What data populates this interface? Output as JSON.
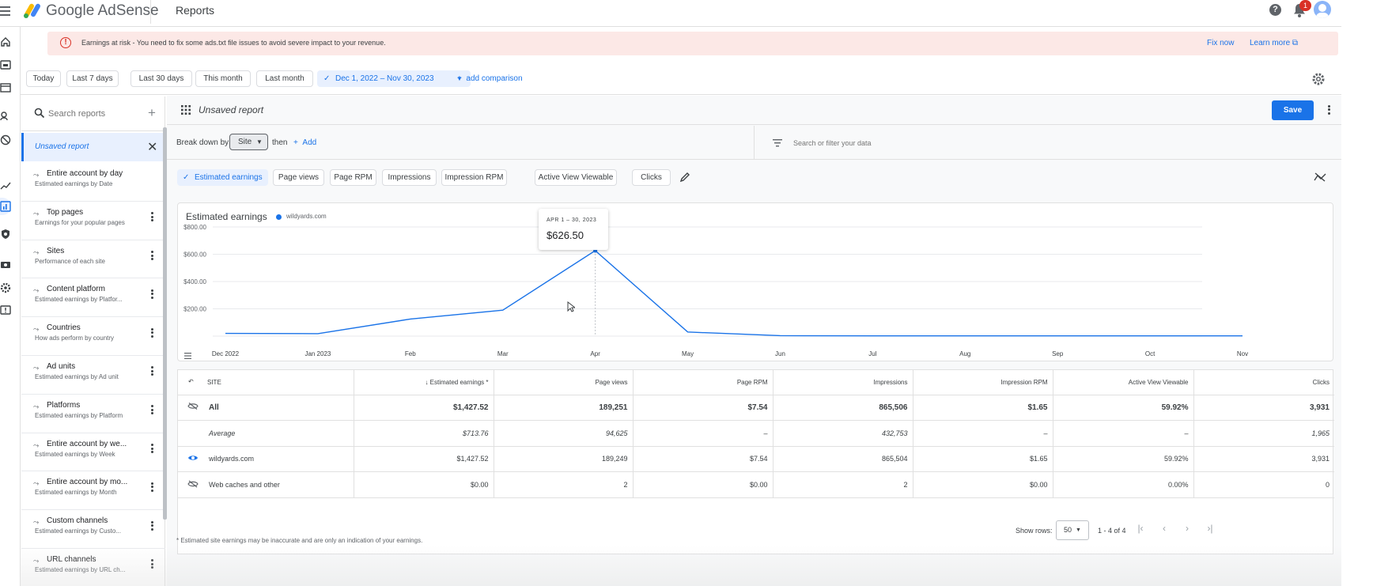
{
  "app": {
    "brand": "Google AdSense",
    "page_title": "Reports",
    "notification_count": "1",
    "help_glyph": "?"
  },
  "alert": {
    "text": "Earnings at risk - You need to fix some ads.txt file issues to avoid severe impact to your revenue.",
    "fix_label": "Fix now",
    "learn_label": "Learn more",
    "color": "#fce8e6"
  },
  "date_range": {
    "presets": [
      "Today",
      "Last 7 days",
      "Last 30 days",
      "This month",
      "Last month"
    ],
    "selected": "Dec 1, 2022 – Nov 30, 2023",
    "add_comparison": "add comparison"
  },
  "sidebar": {
    "search_placeholder": "Search reports",
    "unsaved_label": "Unsaved report",
    "reports": [
      {
        "title": "Entire account by day",
        "subtitle": "Estimated earnings by Date",
        "has_menu": false
      },
      {
        "title": "Top pages",
        "subtitle": "Earnings for your popular pages",
        "has_menu": true
      },
      {
        "title": "Sites",
        "subtitle": "Performance of each site",
        "has_menu": true
      },
      {
        "title": "Content platform",
        "subtitle": "Estimated earnings by Platfor...",
        "has_menu": true
      },
      {
        "title": "Countries",
        "subtitle": "How ads perform by country",
        "has_menu": true
      },
      {
        "title": "Ad units",
        "subtitle": "Estimated earnings by Ad unit",
        "has_menu": true
      },
      {
        "title": "Platforms",
        "subtitle": "Estimated earnings by Platform",
        "has_menu": true
      },
      {
        "title": "Entire account by we...",
        "subtitle": "Estimated earnings by Week",
        "has_menu": true
      },
      {
        "title": "Entire account by mo...",
        "subtitle": "Estimated earnings by Month",
        "has_menu": true
      },
      {
        "title": "Custom channels",
        "subtitle": "Estimated earnings by Custo...",
        "has_menu": true
      },
      {
        "title": "URL channels",
        "subtitle": "Estimated earnings by URL ch...",
        "has_menu": true
      }
    ]
  },
  "report": {
    "name": "Unsaved report",
    "save_label": "Save",
    "breakdown_label": "Break down by",
    "breakdown_value": "Site",
    "then_label": "then",
    "add_label": "Add",
    "filter_placeholder": "Search or filter your data",
    "metrics_active": "Estimated earnings",
    "metrics": [
      "Page views",
      "Page RPM",
      "Impressions",
      "Impression RPM",
      "Active View Viewable",
      "Clicks"
    ]
  },
  "chart_data": {
    "type": "line",
    "title": "Estimated earnings",
    "series": [
      {
        "name": "wildyards.com",
        "color": "#1a73e8",
        "values": [
          20,
          18,
          125,
          190,
          626.5,
          30,
          3,
          2,
          2,
          2,
          2,
          2
        ]
      }
    ],
    "x": [
      "Dec 2022",
      "Jan 2023",
      "Feb",
      "Mar",
      "Apr",
      "May",
      "Jun",
      "Jul",
      "Aug",
      "Sep",
      "Oct",
      "Nov"
    ],
    "yticks": [
      "$200.00",
      "$400.00",
      "$600.00",
      "$800.00"
    ],
    "ylim": [
      0,
      800
    ],
    "grid": true,
    "tooltip": {
      "date": "APR 1 – 30, 2023",
      "value": "$626.50",
      "index": 4
    }
  },
  "table": {
    "headers": [
      "SITE",
      "Estimated earnings *",
      "Page views",
      "Page RPM",
      "Impressions",
      "Impression RPM",
      "Active View Viewable",
      "Clicks"
    ],
    "rows": [
      {
        "kind": "total",
        "cells": [
          "All",
          "$1,427.52",
          "189,251",
          "$7.54",
          "865,506",
          "$1.65",
          "59.92%",
          "3,931"
        ]
      },
      {
        "kind": "avg",
        "cells": [
          "Average",
          "$713.76",
          "94,625",
          "–",
          "432,753",
          "–",
          "–",
          "1,965"
        ]
      },
      {
        "kind": "site",
        "cells": [
          "wildyards.com",
          "$1,427.52",
          "189,249",
          "$7.54",
          "865,504",
          "$1.65",
          "59.92%",
          "3,931"
        ]
      },
      {
        "kind": "other",
        "cells": [
          "Web caches and other",
          "$0.00",
          "2",
          "$0.00",
          "2",
          "$0.00",
          "0.00%",
          "0"
        ]
      }
    ],
    "show_rows_label": "Show rows:",
    "rows_per_page": "50",
    "page_range": "1 - 4 of 4",
    "footnote": "* Estimated site earnings may be inaccurate and are only an indication of your earnings."
  },
  "colors": {
    "accent": "#1a73e8",
    "alert_bg": "#fce8e6",
    "error": "#d93025"
  }
}
